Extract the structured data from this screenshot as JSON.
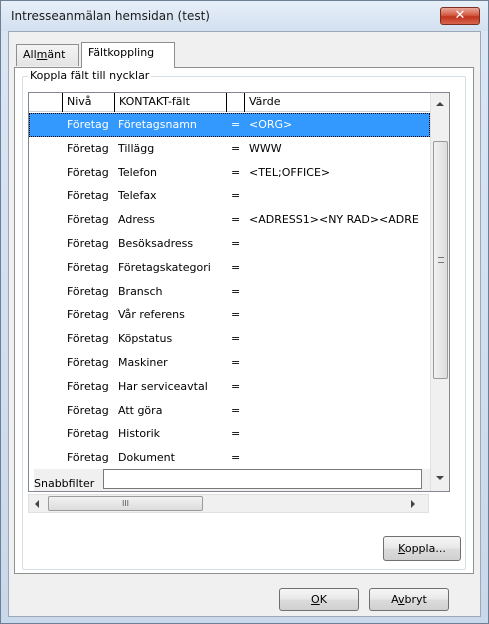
{
  "window": {
    "title": "Intresseanmälan hemsidan (test)",
    "close_glyph": "✕"
  },
  "tabs": [
    {
      "pre": "All",
      "accel": "m",
      "post": "änt",
      "active": false
    },
    {
      "pre": "",
      "accel": "",
      "post": "Fältkoppling",
      "active": true
    }
  ],
  "group": {
    "label": "Koppla fält till nycklar"
  },
  "grid": {
    "headers": {
      "niva": "Nivå",
      "kontakt": "KONTAKT-fält",
      "eq": "",
      "varde": "Värde"
    },
    "rows": [
      {
        "niva": "Företag",
        "kontakt": "Företagsnamn",
        "eq": "=",
        "varde": "<ORG>"
      },
      {
        "niva": "Företag",
        "kontakt": "Tillägg",
        "eq": "=",
        "varde": "WWW"
      },
      {
        "niva": "Företag",
        "kontakt": "Telefon",
        "eq": "=",
        "varde": "<TEL;OFFICE>"
      },
      {
        "niva": "Företag",
        "kontakt": "Telefax",
        "eq": "=",
        "varde": ""
      },
      {
        "niva": "Företag",
        "kontakt": "Adress",
        "eq": "=",
        "varde": "<ADRESS1><NY RAD><ADRE"
      },
      {
        "niva": "Företag",
        "kontakt": "Besöksadress",
        "eq": "=",
        "varde": ""
      },
      {
        "niva": "Företag",
        "kontakt": "Företagskategori",
        "eq": "=",
        "varde": ""
      },
      {
        "niva": "Företag",
        "kontakt": "Bransch",
        "eq": "=",
        "varde": ""
      },
      {
        "niva": "Företag",
        "kontakt": "Vår referens",
        "eq": "=",
        "varde": ""
      },
      {
        "niva": "Företag",
        "kontakt": "Köpstatus",
        "eq": "=",
        "varde": ""
      },
      {
        "niva": "Företag",
        "kontakt": "Maskiner",
        "eq": "=",
        "varde": ""
      },
      {
        "niva": "Företag",
        "kontakt": "Har serviceavtal",
        "eq": "=",
        "varde": ""
      },
      {
        "niva": "Företag",
        "kontakt": "Att göra",
        "eq": "=",
        "varde": ""
      },
      {
        "niva": "Företag",
        "kontakt": "Historik",
        "eq": "=",
        "varde": ""
      },
      {
        "niva": "Företag",
        "kontakt": "Dokument",
        "eq": "=",
        "varde": ""
      }
    ],
    "selected_row": 0
  },
  "filter": {
    "label": "Snabbfilter",
    "value": ""
  },
  "hscroll": {
    "thumb_glyph": "III"
  },
  "buttons": {
    "koppla": {
      "accel": "K",
      "rest": "oppla..."
    },
    "ok": {
      "accel": "O",
      "rest": "K"
    },
    "avbryt": {
      "pre": "A",
      "accel": "v",
      "rest": "bryt"
    }
  }
}
